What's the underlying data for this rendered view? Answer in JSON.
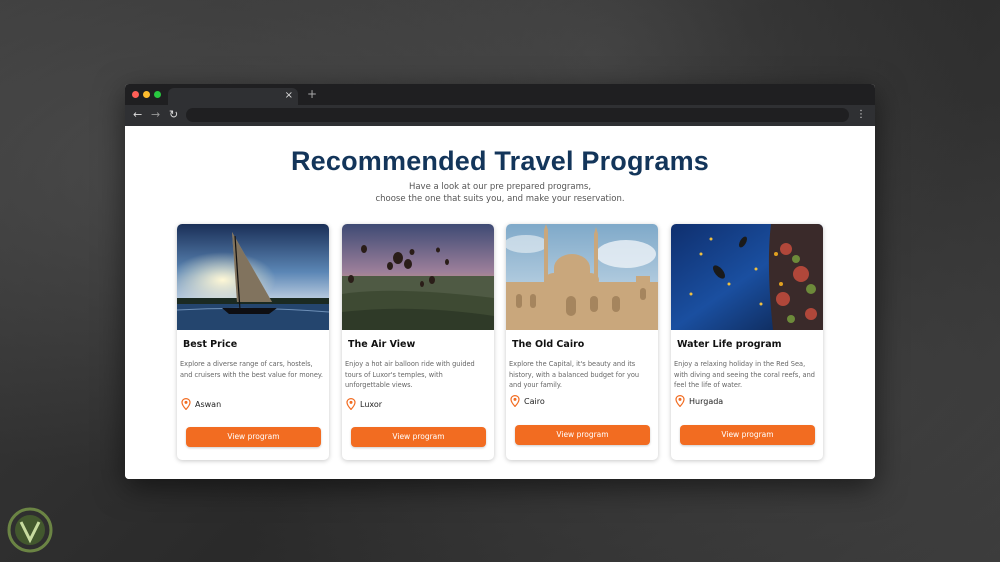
{
  "page": {
    "title": "Recommended Travel Programs",
    "subtitle_line1": "Have a look at our pre prepared programs,",
    "subtitle_line2": "choose the one that suits you, and make your reservation."
  },
  "browser": {
    "tab_close": "×",
    "new_tab": "+",
    "back": "←",
    "forward": "→",
    "reload": "↻",
    "menu": "⋮"
  },
  "cards": [
    {
      "title": "Best Price",
      "description": "Explore a diverse range of cars, hostels, and cruisers with the best value for money.",
      "location": "Aswan",
      "button": "View program"
    },
    {
      "title": "The Air View",
      "description": "Enjoy a hot air balloon ride with guided tours of Luxor's temples, with unforgettable views.",
      "location": "Luxor",
      "button": "View program"
    },
    {
      "title": "The Old Cairo",
      "description": "Explore the Capital, it's beauty and its history, with a balanced budget for you and your family.",
      "location": "Cairo",
      "button": "View program"
    },
    {
      "title": "Water Life program",
      "description": "Enjoy a relaxing holiday in the Red Sea, with diving and seeing the coral reefs, and feel the life of water.",
      "location": "Hurgada",
      "button": "View program"
    }
  ],
  "colors": {
    "accent": "#f26c21",
    "title": "#13355a"
  },
  "icons": [
    "location-pin-icon"
  ]
}
